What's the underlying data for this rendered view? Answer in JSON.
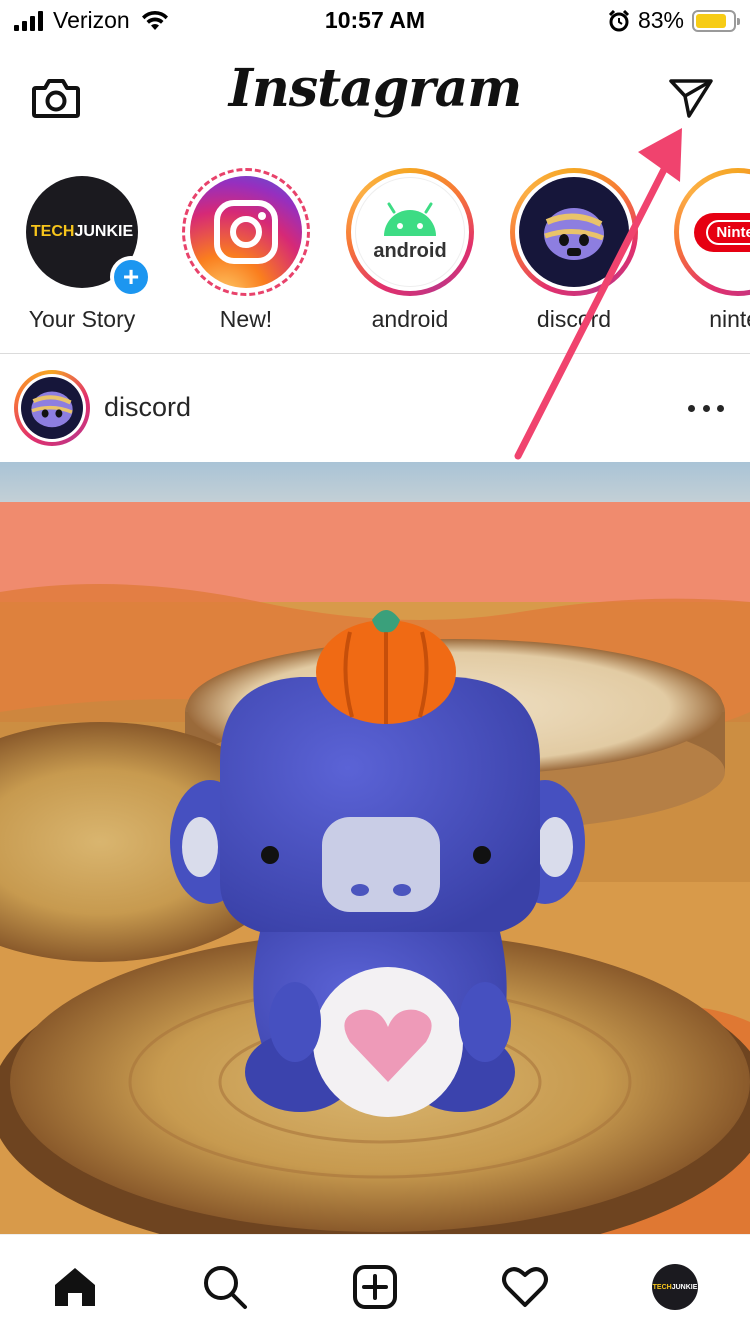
{
  "status_bar": {
    "carrier": "Verizon",
    "time": "10:57 AM",
    "battery_percent": "83%",
    "battery_level": 0.83
  },
  "header": {
    "logo": "Instagram",
    "camera_icon": "camera-icon",
    "direct_icon": "paper-plane-icon"
  },
  "stories": [
    {
      "label": "Your Story",
      "avatar_text_a": "TECH",
      "avatar_text_b": "JUNKIE",
      "badge": "+"
    },
    {
      "label": "New!"
    },
    {
      "label": "android",
      "avatar_text": "android"
    },
    {
      "label": "discord"
    },
    {
      "label": "ninter",
      "avatar_text": "Ninter"
    }
  ],
  "post": {
    "username": "discord",
    "more_icon": "more-horizontal-icon"
  },
  "bottom_nav": {
    "items": [
      "home-icon",
      "search-icon",
      "new-post-icon",
      "activity-heart-icon",
      "profile-avatar"
    ],
    "profile_text_a": "TECH",
    "profile_text_b": "JUNKIE"
  },
  "colors": {
    "accent_blue": "#1c96f0",
    "story_gradient_start": "#f5a623",
    "story_gradient_mid": "#e1306c",
    "annotation_arrow": "#f0436e",
    "battery": "#f7cc15"
  }
}
